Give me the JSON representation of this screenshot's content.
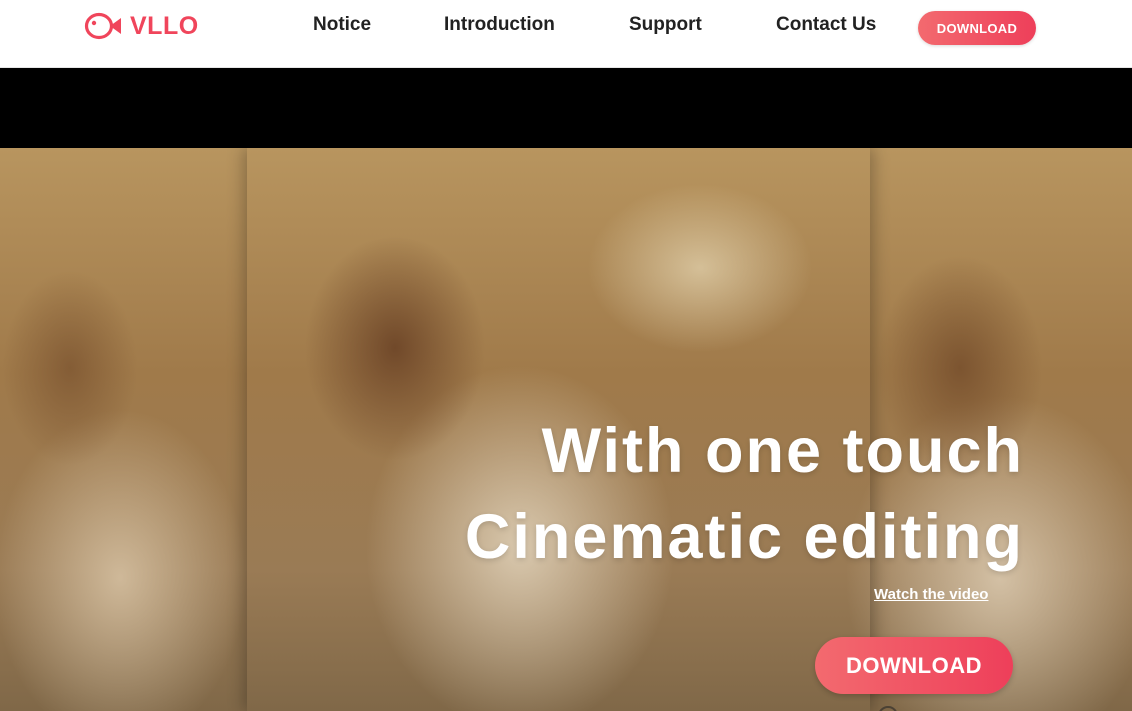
{
  "header": {
    "logo_text": "VLLO",
    "logo_icon": "fish-icon",
    "nav": [
      {
        "label": "Notice"
      },
      {
        "label": "Introduction"
      },
      {
        "label": "Support"
      },
      {
        "label": "Contact Us"
      }
    ],
    "download_label": "DOWNLOAD"
  },
  "hero": {
    "headline_line1": "With one touch",
    "headline_line2": "Cinematic editing",
    "watch_link": "Watch the video",
    "download_label": "DOWNLOAD"
  },
  "colors": {
    "brand": "#f0455b",
    "button_gradient_start": "#f36a6f",
    "button_gradient_end": "#ee3f5a"
  }
}
